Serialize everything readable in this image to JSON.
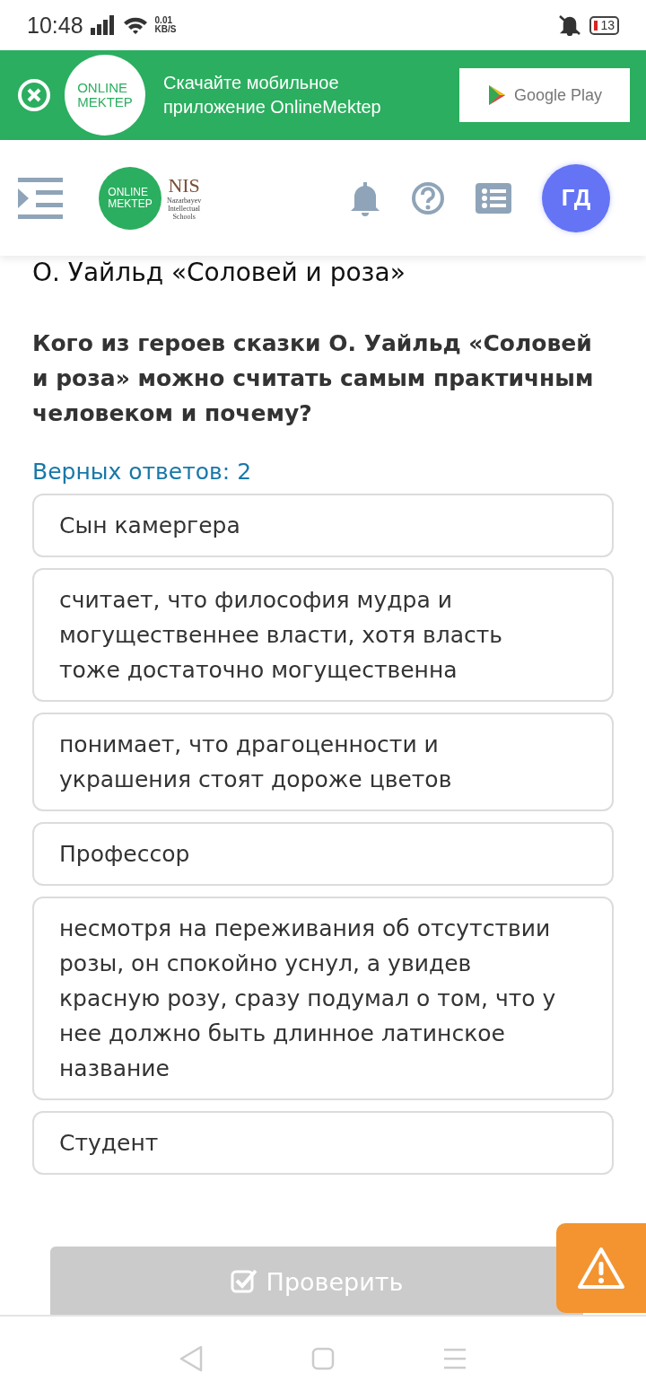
{
  "status_bar": {
    "time": "10:48",
    "speed_value": "0.01",
    "speed_unit": "KB/S",
    "battery": "13"
  },
  "banner": {
    "text": "Скачайте мобильное приложение OnlineMektep",
    "logo_line_1": "ONLINE",
    "logo_line_2": "MEKTEP",
    "store_button": "Google Play"
  },
  "header": {
    "logo_line_1": "ONLINE",
    "logo_line_2": "MEKTEP",
    "partner_name": "NIS",
    "partner_line_1": "Nazarbayev",
    "partner_line_2": "Intellectual",
    "partner_line_3": "Schools",
    "avatar": "ГД"
  },
  "lesson_title": "О. Уайльд «Соловей и роза»",
  "question": "Кого из героев сказки О. Уайльд «Соловей и роза» можно считать самым практичным человеком и почему?",
  "answers_hint": "Верных ответов: 2",
  "options": [
    {
      "text": "Сын камергера"
    },
    {
      "text": "считает, что философия мудра и могущественнее власти, хотя власть тоже достаточно могущественна"
    },
    {
      "text": "понимает, что драгоценности и украшения стоят дороже цветов"
    },
    {
      "text": "Профессор"
    },
    {
      "text": "несмотря на переживания об отсутствии розы, он спокойно уснул, а увидев красную розу, сразу подумал о том, что у нее должно быть длинное латинское название"
    },
    {
      "text": "Студент"
    }
  ],
  "check_button": {
    "label": "Проверить",
    "disabled": true
  }
}
